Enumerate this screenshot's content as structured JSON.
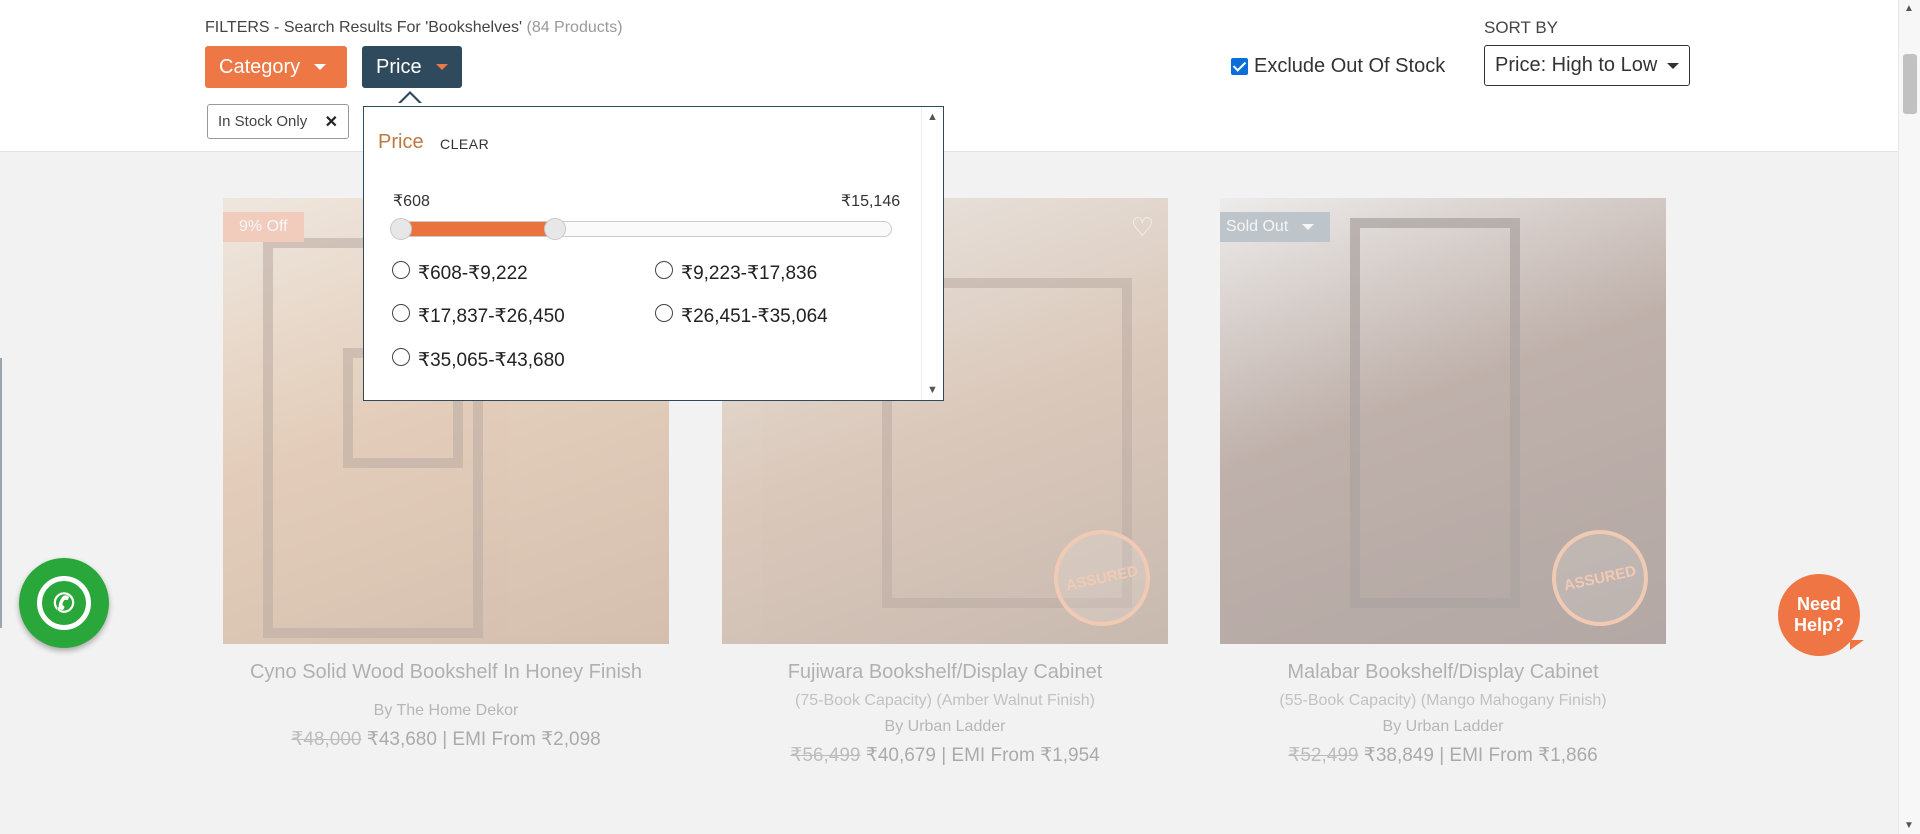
{
  "header": {
    "filters_prefix": "FILTERS - Search Results For 'Bookshelves'",
    "product_count": "(84 Products)",
    "category_label": "Category",
    "price_label": "Price",
    "active_chip": "In Stock Only",
    "chip_remove": "✕",
    "exclude_label": "Exclude Out Of Stock",
    "sort_label": "SORT BY",
    "sort_value": "Price: High to Low"
  },
  "price_panel": {
    "title": "Price",
    "clear": "CLEAR",
    "range_min": "₹608",
    "range_max": "₹15,146",
    "slider_fill_fraction": 0.325,
    "options": [
      "₹608-₹9,222",
      "₹9,223-₹17,836",
      "₹17,837-₹26,450",
      "₹26,451-₹35,064",
      "₹35,065-₹43,680"
    ]
  },
  "products": [
    {
      "badge": "9% Off",
      "title": "Cyno Solid Wood Bookshelf In Honey Finish",
      "subtitle": "",
      "by": "By The Home Dekor",
      "mrp": "₹48,000",
      "price": "₹43,680",
      "emi": "| EMI From ₹2,098"
    },
    {
      "badge": "",
      "title": "Fujiwara Bookshelf/Display Cabinet",
      "subtitle": "(75-Book Capacity) (Amber Walnut Finish)",
      "by": "By Urban Ladder",
      "mrp": "₹56,499",
      "price": "₹40,679",
      "emi": "| EMI From ₹1,954",
      "assured": "ASSURED"
    },
    {
      "badge": "Sold Out",
      "title": "Malabar Bookshelf/Display Cabinet",
      "subtitle": "(55-Book Capacity) (Mango Mahogany Finish)",
      "by": "By Urban Ladder",
      "mrp": "₹52,499",
      "price": "₹38,849",
      "emi": "| EMI From ₹1,866",
      "assured": "ASSURED"
    }
  ],
  "floating": {
    "need_help": "Need Help?"
  },
  "icons": {
    "whatsapp": "whatsapp-icon",
    "caret": "caret-down-icon",
    "heart": "heart-icon"
  },
  "colors": {
    "accent": "#ed7745",
    "price_button": "#2f4a5c",
    "whatsapp": "#2aa73a"
  }
}
